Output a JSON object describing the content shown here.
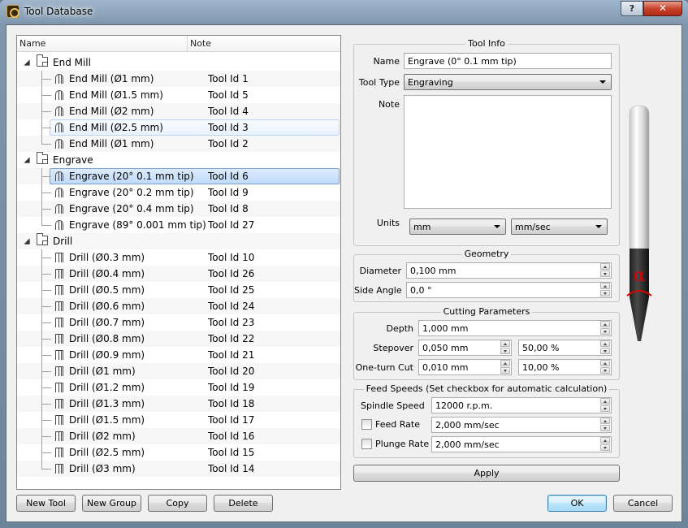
{
  "window": {
    "title": "Tool Database",
    "help_label": "?",
    "close_label": "✕"
  },
  "tree": {
    "columns": [
      "Name",
      "Note"
    ],
    "groups": [
      {
        "label": "End Mill",
        "tools": [
          {
            "label": "End Mill (Ø1 mm)",
            "note": "Tool Id 1"
          },
          {
            "label": "End Mill (Ø1.5 mm)",
            "note": "Tool Id 5"
          },
          {
            "label": "End Mill (Ø2 mm)",
            "note": "Tool Id 4"
          },
          {
            "label": "End Mill (Ø2.5 mm)",
            "note": "Tool Id 3"
          },
          {
            "label": "End Mill (Ø1 mm)",
            "note": "Tool Id 2"
          }
        ]
      },
      {
        "label": "Engrave",
        "tools": [
          {
            "label": "Engrave (20° 0.1 mm tip)",
            "note": "Tool Id 6"
          },
          {
            "label": "Engrave (20° 0.2 mm tip)",
            "note": "Tool Id 9"
          },
          {
            "label": "Engrave (20° 0.4 mm tip)",
            "note": "Tool Id 8"
          },
          {
            "label": "Engrave (89° 0.001 mm tip)",
            "note": "Tool Id 27"
          }
        ]
      },
      {
        "label": "Drill",
        "tools": [
          {
            "label": "Drill (Ø0.3 mm)",
            "note": "Tool Id 10"
          },
          {
            "label": "Drill (Ø0.4 mm)",
            "note": "Tool Id 26"
          },
          {
            "label": "Drill (Ø0.5 mm)",
            "note": "Tool Id 25"
          },
          {
            "label": "Drill (Ø0.6 mm)",
            "note": "Tool Id 24"
          },
          {
            "label": "Drill (Ø0.7 mm)",
            "note": "Tool Id 23"
          },
          {
            "label": "Drill (Ø0.8 mm)",
            "note": "Tool Id 22"
          },
          {
            "label": "Drill (Ø0.9 mm)",
            "note": "Tool Id 21"
          },
          {
            "label": "Drill (Ø1 mm)",
            "note": "Tool Id 20"
          },
          {
            "label": "Drill (Ø1.2 mm)",
            "note": "Tool Id 19"
          },
          {
            "label": "Drill (Ø1.3 mm)",
            "note": "Tool Id 18"
          },
          {
            "label": "Drill (Ø1.5 mm)",
            "note": "Tool Id 17"
          },
          {
            "label": "Drill (Ø2 mm)",
            "note": "Tool Id 16"
          },
          {
            "label": "Drill (Ø2.5 mm)",
            "note": "Tool Id 15"
          },
          {
            "label": "Drill (Ø3 mm)",
            "note": "Tool Id 14"
          }
        ]
      }
    ],
    "selected_tool": "Engrave (20° 0.1 mm tip)",
    "hovered_tool": "End Mill (Ø2.5 mm)"
  },
  "buttons": {
    "new_tool": "New Tool",
    "new_group": "New Group",
    "copy": "Copy",
    "delete": "Delete",
    "apply": "Apply",
    "ok": "OK",
    "cancel": "Cancel"
  },
  "tool_info": {
    "title": "Tool Info",
    "name_label": "Name",
    "name_value": "Engrave (0° 0.1 mm tip)",
    "type_label": "Tool Type",
    "type_value": "Engraving",
    "note_label": "Note",
    "note_value": "",
    "units_label": "Units",
    "units_length": "mm",
    "units_speed": "mm/sec"
  },
  "geometry": {
    "title": "Geometry",
    "diameter_label": "Diameter",
    "diameter_value": "0,100 mm",
    "side_angle_label": "Side Angle",
    "side_angle_value": "0,0 °"
  },
  "cutting": {
    "title": "Cutting Parameters",
    "depth_label": "Depth",
    "depth_value": "1,000 mm",
    "stepover_label": "Stepover",
    "stepover_value": "0,050 mm",
    "stepover_percent": "50,00 %",
    "oneturn_label": "One-turn Cut",
    "oneturn_value": "0,010 mm",
    "oneturn_percent": "10,00 %"
  },
  "feeds": {
    "title": "Feed Speeds (Set checkbox for automatic calculation)",
    "spindle_label": "Spindle Speed",
    "spindle_value": "12000 r.p.m.",
    "feed_label": "Feed Rate",
    "feed_value": "2,000 mm/sec",
    "feed_auto": false,
    "plunge_label": "Plunge Rate",
    "plunge_value": "2,000 mm/sec",
    "plunge_auto": false
  },
  "illustration": {
    "angle_symbol": "α",
    "accent_color": "#e00000"
  }
}
